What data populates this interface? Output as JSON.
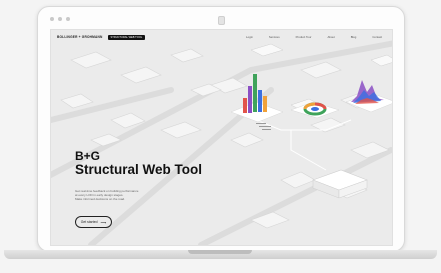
{
  "nav": {
    "brand": "BOLLINGER + GROHMANN",
    "badge": "STRUCTURAL WEB TOOL",
    "links": [
      "Login",
      "Services",
      "Product Tour",
      "About",
      "Blog",
      "Contact"
    ]
  },
  "hero": {
    "title_line1": "B+G",
    "title_line2": "Structural Web Tool",
    "description": [
      "Get real-time feedback on building performance",
      "at every LOD in early design stages.",
      "Make informed decisions on the road."
    ],
    "cta_label": "Get started",
    "cta_arrow": "⟶"
  },
  "colors": {
    "accent": "#3b6fe0",
    "chart_green": "#3fa35b",
    "chart_purple": "#8b4fc4",
    "chart_orange": "#f0a13a",
    "chart_red": "#e2534a"
  }
}
